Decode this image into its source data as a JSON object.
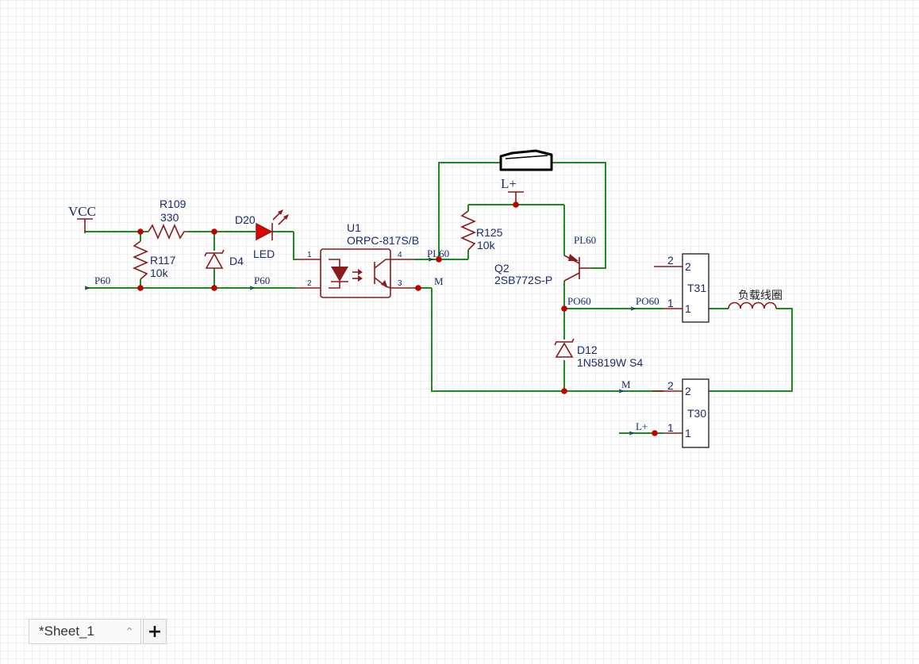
{
  "components": {
    "vcc": {
      "label": "VCC"
    },
    "r109": {
      "ref": "R109",
      "value": "330"
    },
    "r117": {
      "ref": "R117",
      "value": "10k"
    },
    "d4": {
      "ref": "D4"
    },
    "d20": {
      "ref": "D20",
      "value": "LED"
    },
    "u1": {
      "ref": "U1",
      "value": "ORPC-817S/B",
      "pins": [
        "1",
        "2",
        "3",
        "4"
      ]
    },
    "r125": {
      "ref": "R125",
      "value": "10k"
    },
    "q2": {
      "ref": "Q2",
      "value": "2SB772S-P"
    },
    "d12": {
      "ref": "D12",
      "value": "1N5819W S4"
    },
    "t31": {
      "ref": "T31",
      "pins": [
        "2",
        "1"
      ],
      "pin_labels": [
        "2",
        "1"
      ]
    },
    "t30": {
      "ref": "T30",
      "pins": [
        "2",
        "1"
      ],
      "pin_labels": [
        "2",
        "1"
      ]
    },
    "coil": {
      "label": "负载线圈"
    }
  },
  "nets": {
    "p60_left": "P60",
    "p60_mid": "P60",
    "pl60_u1": "PL60",
    "pl60_q2": "PL60",
    "m_u1": "M",
    "m_bottom": "M",
    "l_plus_top": "L+",
    "l_plus_t30": "L+",
    "po60_q2": "PO60",
    "po60_t31": "PO60"
  },
  "sheet_tabs": {
    "active_tab": "*Sheet_1",
    "add_label": "+"
  }
}
